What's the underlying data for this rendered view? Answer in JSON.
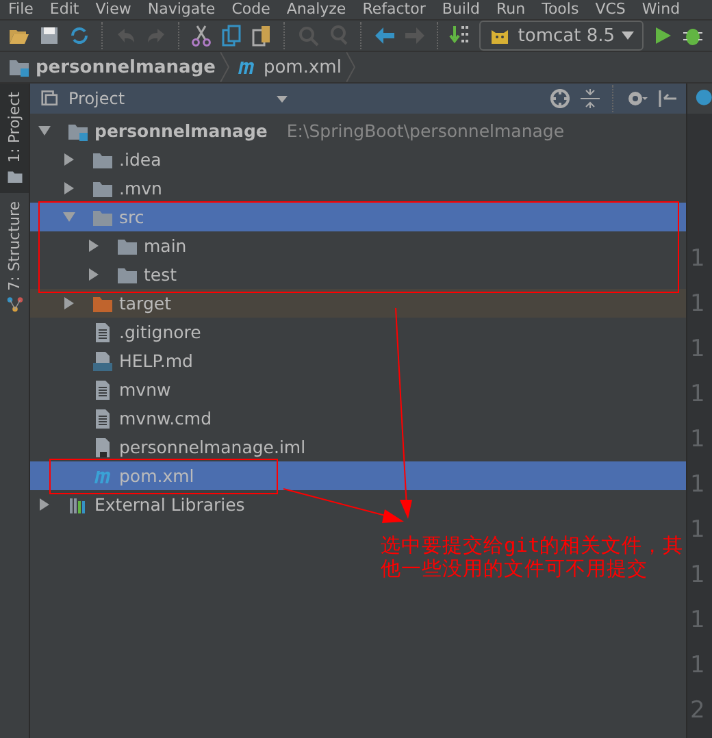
{
  "menu": [
    "File",
    "Edit",
    "View",
    "Navigate",
    "Code",
    "Analyze",
    "Refactor",
    "Build",
    "Run",
    "Tools",
    "VCS",
    "Wind"
  ],
  "toolbar": {
    "run_config": "tomcat 8.5"
  },
  "breadcrumbs": [
    {
      "label": "personnelmanage",
      "kind": "project"
    },
    {
      "label": "pom.xml",
      "kind": "maven-file"
    }
  ],
  "tool_tabs": [
    {
      "label": "1: Project",
      "selected": true,
      "kind": "project"
    },
    {
      "label": "7: Structure",
      "selected": false,
      "kind": "structure"
    }
  ],
  "panel": {
    "title": "Project"
  },
  "tree": [
    {
      "label": "personnelmanage",
      "path": "E:\\SpringBoot\\personnelmanage",
      "kind": "module",
      "expanded": true,
      "selected": false,
      "children": [
        {
          "label": ".idea",
          "kind": "folder",
          "expanded": false,
          "selected": false
        },
        {
          "label": ".mvn",
          "kind": "folder",
          "expanded": false,
          "selected": false
        },
        {
          "label": "src",
          "kind": "folder",
          "expanded": true,
          "selected": true,
          "children": [
            {
              "label": "main",
              "kind": "folder",
              "expanded": false,
              "selected": false
            },
            {
              "label": "test",
              "kind": "folder",
              "expanded": false,
              "selected": false
            }
          ]
        },
        {
          "label": "target",
          "kind": "excluded-folder",
          "expanded": false,
          "selected": false
        },
        {
          "label": ".gitignore",
          "kind": "file",
          "selected": false
        },
        {
          "label": "HELP.md",
          "kind": "md-file",
          "selected": false
        },
        {
          "label": "mvnw",
          "kind": "file",
          "selected": false
        },
        {
          "label": "mvnw.cmd",
          "kind": "file",
          "selected": false
        },
        {
          "label": "personnelmanage.iml",
          "kind": "module-file",
          "selected": false
        },
        {
          "label": "pom.xml",
          "kind": "maven-file",
          "selected": true
        }
      ]
    },
    {
      "label": "External Libraries",
      "kind": "library",
      "expanded": false,
      "selected": false
    }
  ],
  "gutter": [
    "1",
    "1",
    "1",
    "1",
    "1",
    "1",
    "1",
    "1",
    "1",
    "1",
    "2"
  ],
  "annotation": {
    "text": "选中要提交给git的相关文件，其他一些没用的文件可不用提交"
  }
}
